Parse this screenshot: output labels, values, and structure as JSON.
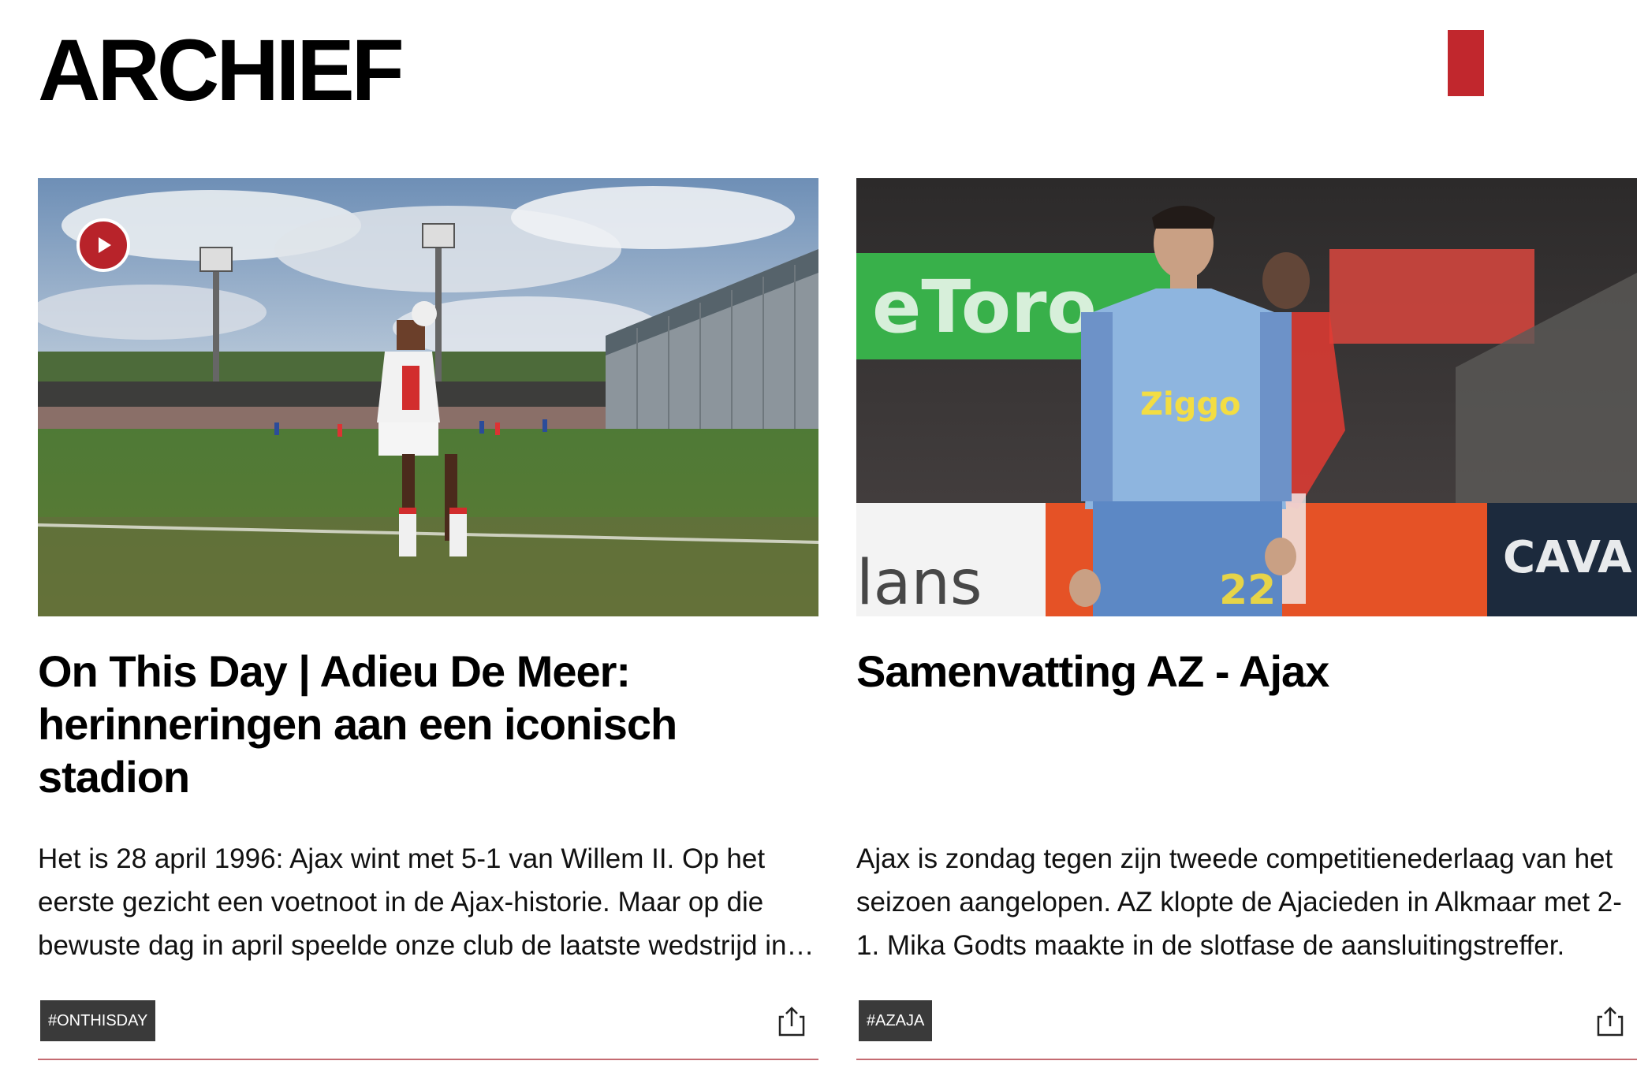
{
  "page": {
    "title": "ARCHIEF"
  },
  "theme": {
    "accent": "#c1272d",
    "tag_bg": "#3a3a3a",
    "divider": "#c46b72"
  },
  "cards": [
    {
      "title": "On This Day | Adieu De Meer: herinneringen aan een iconisch stadion",
      "excerpt": "Het is 28 april 1996: Ajax wint met 5-1 van Willem II. Op het eerste gezicht een voetnoot in de Ajax-historie. Maar op die bewuste dag in april speelde onze club de laatste wedstrijd in De Meer.",
      "tag": "#ONTHISDAY",
      "image": "throw-in-photo",
      "has_video": true,
      "icons": [
        "play-icon",
        "share-icon"
      ]
    },
    {
      "title": "Samenvatting AZ - Ajax",
      "excerpt": "Ajax is zondag tegen zijn tweede competitienederlaag van het seizoen aangelopen. AZ klopte de Ajacieden in Alkmaar met 2-1. Mika Godts maakte in de slotfase de aansluitingstreffer.",
      "tag": "#AZAJA",
      "image": "player-photo",
      "has_video": false,
      "icons": [
        "share-icon"
      ]
    }
  ]
}
